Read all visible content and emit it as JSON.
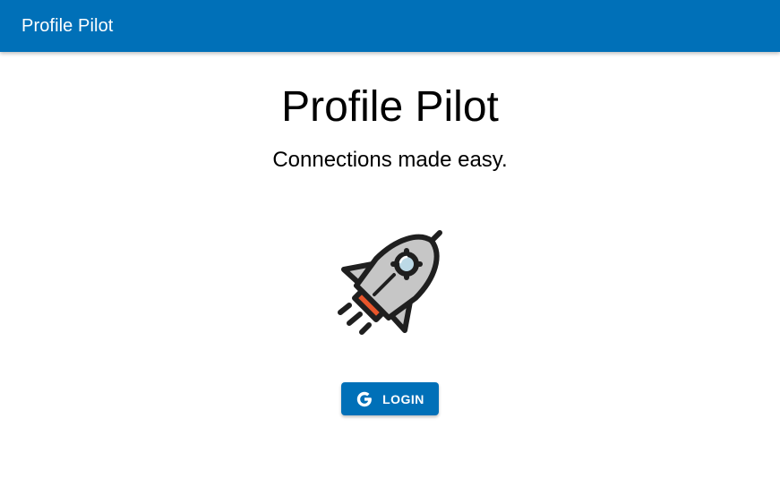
{
  "appbar": {
    "title": "Profile Pilot"
  },
  "hero": {
    "title": "Profile Pilot",
    "subtitle": "Connections made easy.",
    "illustration": "rocket-icon"
  },
  "login_button": {
    "label": "LOGIN",
    "icon": "google-icon"
  },
  "colors": {
    "brand": "#0070b8",
    "background": "#ffffff",
    "text": "#000000"
  }
}
